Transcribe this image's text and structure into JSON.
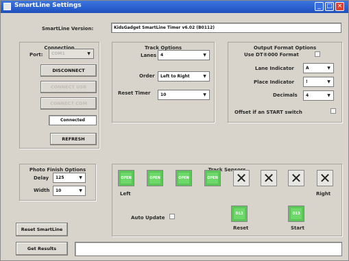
{
  "window": {
    "title": "SmartLine Settings",
    "minimize": "_",
    "maximize": "□",
    "close": "×"
  },
  "version": {
    "label": "SmartLine Version:",
    "value": "KidsGadget SmartLine Timer v6.02 (B0112)"
  },
  "connection": {
    "title": "Connection",
    "port_label": "Port:",
    "port_value": "COM1",
    "disconnect": "DISCONNECT",
    "btn2": "CONNECT USB",
    "btn3": "CONNECT COM",
    "status": "Connected",
    "refresh": "REFRESH"
  },
  "track": {
    "title": "Track Options",
    "lanes_label": "Lanes",
    "lanes_value": "4",
    "order_label": "Order",
    "order_value": "Left to Right",
    "reset_label": "Reset Timer",
    "reset_value": "10"
  },
  "output": {
    "title": "Output Format Options",
    "dt_label": "Use DT®000 Format",
    "lane_ind_label": "Lane Indicator",
    "lane_ind_value": "A",
    "place_ind_label": "Place Indicator",
    "place_ind_value": "!",
    "decimals_label": "Decimals",
    "decimals_value": "4",
    "offset_label": "Offset if an START switch"
  },
  "photo": {
    "title": "Photo Finish Options",
    "delay_label": "Delay",
    "delay_value": "125",
    "width_label": "Width",
    "width_value": "10"
  },
  "sensors": {
    "title": "Track Sensors",
    "on_text": "OPEN",
    "off_text": "✕",
    "left": "Left",
    "right": "Right",
    "auto_update": "Auto Update",
    "trig_text": "D13",
    "reset": "Reset",
    "start": "Start"
  },
  "buttons": {
    "reset_smartline": "Reset SmartLine",
    "get_results": "Get Results"
  }
}
